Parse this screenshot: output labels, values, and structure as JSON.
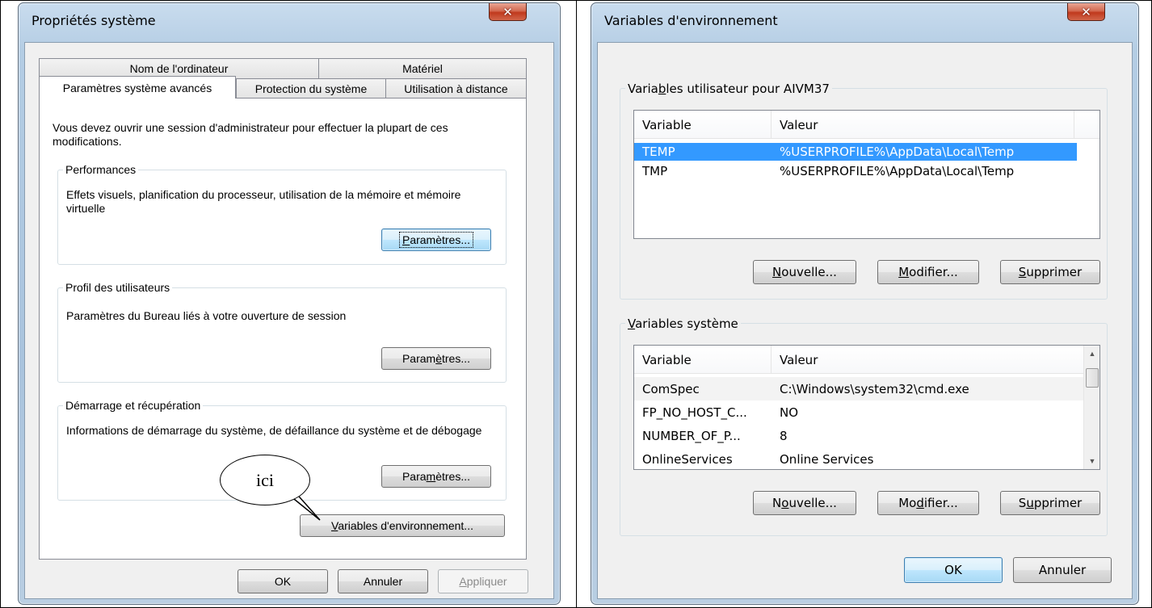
{
  "left_dialog": {
    "title": "Propriétés système",
    "close_glyph": "✕",
    "tabs_row1": [
      {
        "label": "Nom de l'ordinateur"
      },
      {
        "label": "Matériel"
      }
    ],
    "tabs_row2": [
      {
        "label": "Paramètres système avancés",
        "active": true
      },
      {
        "label": "Protection du système"
      },
      {
        "label": "Utilisation à distance"
      }
    ],
    "admin_note": "Vous devez ouvrir une session d'administrateur pour effectuer la plupart de ces modifications.",
    "performances": {
      "label": "Performances",
      "text": "Effets visuels, planification du processeur, utilisation de la mémoire et mémoire virtuelle",
      "button_pre": "",
      "button_ul": "P",
      "button_post": "aramètres..."
    },
    "profil": {
      "label": "Profil des utilisateurs",
      "text": "Paramètres du Bureau liés à votre ouverture de session",
      "button_pre": "Param",
      "button_ul": "è",
      "button_post": "tres..."
    },
    "demarrage": {
      "label": "Démarrage et récupération",
      "text": "Informations de démarrage du système, de défaillance du système et de débogage",
      "button_pre": "Para",
      "button_ul": "m",
      "button_post": "ètres..."
    },
    "env_button": {
      "pre": "",
      "ul": "V",
      "post": "ariables d'environnement..."
    },
    "callout": "ici",
    "buttons": {
      "ok": "OK",
      "cancel": "Annuler",
      "apply_ul": "A",
      "apply_post": "ppliquer"
    }
  },
  "right_dialog": {
    "title": "Variables d'environnement",
    "close_glyph": "✕",
    "user_group": {
      "pre": "Varia",
      "ul": "b",
      "post": "les utilisateur pour AIVM37"
    },
    "user_columns": [
      "Variable",
      "Valeur"
    ],
    "user_rows": [
      {
        "name": "TEMP",
        "value": "%USERPROFILE%\\AppData\\Local\\Temp",
        "selected": true
      },
      {
        "name": "TMP",
        "value": "%USERPROFILE%\\AppData\\Local\\Temp"
      }
    ],
    "user_buttons": {
      "new": {
        "ul": "N",
        "post": "ouvelle..."
      },
      "edit": {
        "ul": "M",
        "post": "odifier..."
      },
      "delete": {
        "ul": "S",
        "post": "upprimer"
      }
    },
    "system_group": {
      "ul": "V",
      "post": "ariables système"
    },
    "system_columns": [
      "Variable",
      "Valeur"
    ],
    "system_rows": [
      {
        "name": "ComSpec",
        "value": "C:\\Windows\\system32\\cmd.exe"
      },
      {
        "name": "FP_NO_HOST_C...",
        "value": "NO"
      },
      {
        "name": "NUMBER_OF_P...",
        "value": "8"
      },
      {
        "name": "OnlineServices",
        "value": "Online Services"
      }
    ],
    "system_buttons": {
      "new": {
        "pre": "N",
        "ul": "o",
        "post": "uvelle..."
      },
      "edit": {
        "pre": "Mo",
        "ul": "d",
        "post": "ifier..."
      },
      "delete": {
        "pre": "S",
        "ul": "u",
        "post": "pprimer"
      }
    },
    "buttons": {
      "ok": "OK",
      "cancel": "Annuler"
    }
  }
}
